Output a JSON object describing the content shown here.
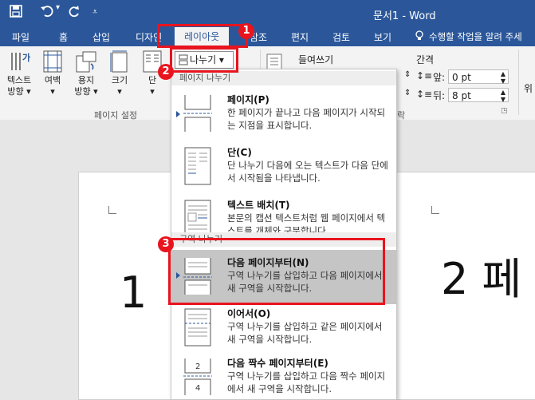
{
  "window": {
    "title": "문서1 - Word"
  },
  "quick_access": {
    "save_icon": "save-icon",
    "undo_icon": "undo-icon",
    "redo_icon": "redo-icon",
    "customize_icon": "customize-icon"
  },
  "tabs": [
    {
      "label": "파일"
    },
    {
      "label": "홈"
    },
    {
      "label": "삽입"
    },
    {
      "label": "디자인"
    },
    {
      "label": "레이아웃"
    },
    {
      "label": "참조"
    },
    {
      "label": "편지"
    },
    {
      "label": "검토"
    },
    {
      "label": "보기"
    },
    {
      "label": "수행할 작업을 알려 주세"
    }
  ],
  "ribbon": {
    "text_direction": {
      "line1": "텍스트",
      "line2": "방향 ▾"
    },
    "margins": {
      "line1": "여백",
      "line2": "▾"
    },
    "orientation": {
      "line1": "용지",
      "line2": "방향 ▾"
    },
    "size": {
      "line1": "크기",
      "line2": "▾"
    },
    "columns": {
      "line1": "단",
      "line2": "▾"
    },
    "page_setup_label": "페이지 설정",
    "breaks_label": "나누기 ▾",
    "indent_label": "들여쓰기",
    "spacing_label": "간격",
    "before_label": "앞:",
    "before_value": "0 pt",
    "after_label": "뒤:",
    "after_value": "8 pt",
    "paragraph_label": "락",
    "position_label": "위"
  },
  "breaks_menu": {
    "page_breaks_header": "페이지 나누기",
    "section_breaks_header": "구역 나누기",
    "items": [
      {
        "title": "페이지(P)",
        "desc": "한 페이지가 끝나고 다음 페이지가 시작되는 지점을 표시합니다."
      },
      {
        "title": "단(C)",
        "desc": "단 나누기 다음에 오는 텍스트가 다음 단에서 시작됨을 나타냅니다."
      },
      {
        "title": "텍스트 배치(T)",
        "desc": "본문의 캡션 텍스트처럼 웹 페이지에서 텍스트를 개체와 구분합니다."
      },
      {
        "title": "다음 페이지부터(N)",
        "desc": "구역 나누기를 삽입하고 다음 페이지에서 새 구역을 시작합니다."
      },
      {
        "title": "이어서(O)",
        "desc": "구역 나누기를 삽입하고 같은 페이지에서 새 구역을 시작합니다."
      },
      {
        "title": "다음 짝수 페이지부터(E)",
        "desc": "구역 나누기를 삽입하고 다음 짝수 페이지에서 새 구역을 시작합니다."
      }
    ]
  },
  "document": {
    "page1_text": "1",
    "page2_text": "2 페"
  },
  "annotations": {
    "step1": "1",
    "step2": "2",
    "step3": "3"
  },
  "colors": {
    "word_blue": "#2b579a",
    "highlight_red": "#e8141e"
  }
}
